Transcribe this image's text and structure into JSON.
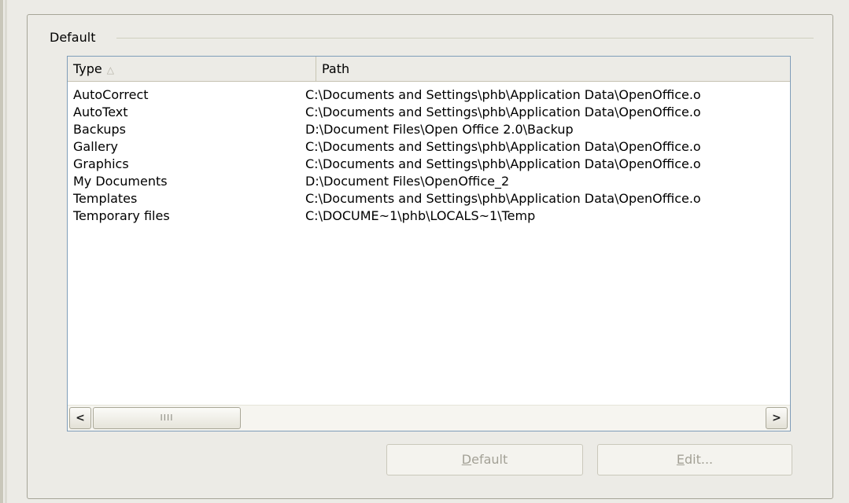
{
  "group": {
    "label": "Default"
  },
  "table": {
    "headers": {
      "type": "Type",
      "path": "Path"
    },
    "sort_indicator": "△",
    "rows": [
      {
        "type": "AutoCorrect",
        "path": "C:\\Documents and Settings\\phb\\Application Data\\OpenOffice.o"
      },
      {
        "type": "AutoText",
        "path": "C:\\Documents and Settings\\phb\\Application Data\\OpenOffice.o"
      },
      {
        "type": "Backups",
        "path": "D:\\Document Files\\Open Office 2.0\\Backup"
      },
      {
        "type": "Gallery",
        "path": "C:\\Documents and Settings\\phb\\Application Data\\OpenOffice.o"
      },
      {
        "type": "Graphics",
        "path": "C:\\Documents and Settings\\phb\\Application Data\\OpenOffice.o"
      },
      {
        "type": "My Documents",
        "path": "D:\\Document Files\\OpenOffice_2"
      },
      {
        "type": "Templates",
        "path": "C:\\Documents and Settings\\phb\\Application Data\\OpenOffice.o"
      },
      {
        "type": "Temporary files",
        "path": "C:\\DOCUME~1\\phb\\LOCALS~1\\Temp"
      }
    ]
  },
  "scrollbar": {
    "left_arrow": "<",
    "right_arrow": ">",
    "thumb_grip": "IIII"
  },
  "buttons": {
    "default": {
      "mnemonic": "D",
      "rest": "efault"
    },
    "edit": {
      "mnemonic": "E",
      "rest": "dit..."
    }
  }
}
